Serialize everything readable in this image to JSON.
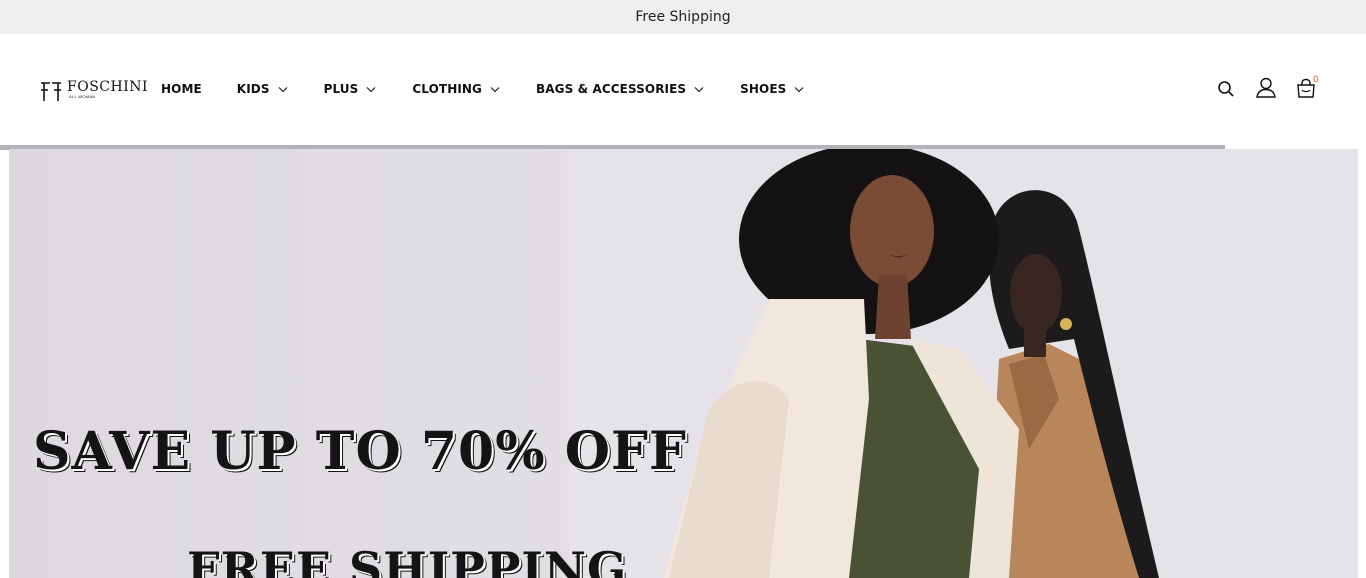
{
  "announcement": {
    "text": "Free Shipping"
  },
  "brand": {
    "name": "FOSCHINI",
    "tagline": "ALL WOMAN"
  },
  "nav": {
    "items": [
      {
        "label": "HOME",
        "has_dropdown": false
      },
      {
        "label": "KIDS",
        "has_dropdown": true
      },
      {
        "label": "PLUS",
        "has_dropdown": true
      },
      {
        "label": "CLOTHING",
        "has_dropdown": true
      },
      {
        "label": "BAGS & ACCESSORIES",
        "has_dropdown": true
      },
      {
        "label": "SHOES",
        "has_dropdown": true
      }
    ]
  },
  "header_actions": {
    "search_icon": "search-icon",
    "account_icon": "user-icon",
    "cart_icon": "bag-icon",
    "cart_count": "0"
  },
  "slider": {
    "progress": 0.897
  },
  "hero": {
    "headline": "SAVE UP TO 70% OFF",
    "subheadline": "FREE SHIPPING"
  },
  "colors": {
    "announcement_bg": "#efefef",
    "cart_badge": "#e05a2b",
    "hero_bg": "#e2dfe4",
    "progress": "#b3b3b8"
  }
}
